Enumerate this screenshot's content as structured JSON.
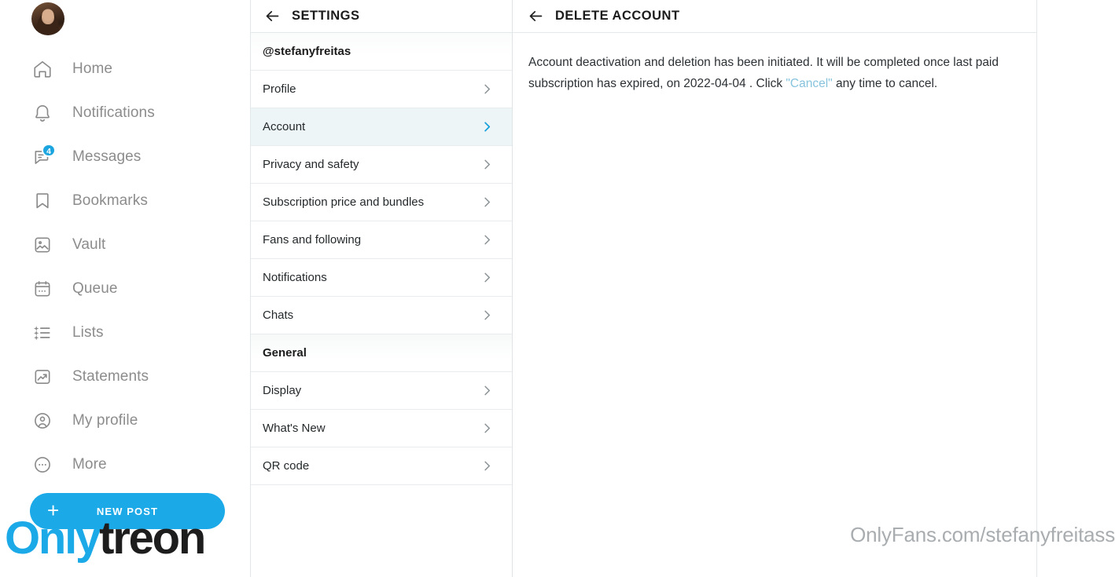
{
  "sidebar": {
    "avatar_alt": "user-avatar",
    "items": [
      {
        "label": "Home",
        "icon": "home-icon",
        "badge": null
      },
      {
        "label": "Notifications",
        "icon": "bell-icon",
        "badge": null
      },
      {
        "label": "Messages",
        "icon": "messages-icon",
        "badge": "4"
      },
      {
        "label": "Bookmarks",
        "icon": "bookmark-icon",
        "badge": null
      },
      {
        "label": "Vault",
        "icon": "vault-image-icon",
        "badge": null
      },
      {
        "label": "Queue",
        "icon": "calendar-icon",
        "badge": null
      },
      {
        "label": "Lists",
        "icon": "list-star-icon",
        "badge": null
      },
      {
        "label": "Statements",
        "icon": "chart-frame-icon",
        "badge": null
      },
      {
        "label": "My profile",
        "icon": "profile-circle-icon",
        "badge": null
      },
      {
        "label": "More",
        "icon": "ellipsis-circle-icon",
        "badge": null
      }
    ],
    "new_post_label": "NEW POST",
    "new_post_icon": "plus-icon",
    "brand_primary": "Only",
    "brand_secondary": "treon"
  },
  "settings": {
    "header_title": "SETTINGS",
    "back_icon": "arrow-left-icon",
    "username": "@stefanyfreitas",
    "account_rows": [
      {
        "label": "Profile",
        "active": false
      },
      {
        "label": "Account",
        "active": true
      },
      {
        "label": "Privacy and safety",
        "active": false
      },
      {
        "label": "Subscription price and bundles",
        "active": false
      },
      {
        "label": "Fans and following",
        "active": false
      },
      {
        "label": "Notifications",
        "active": false
      },
      {
        "label": "Chats",
        "active": false
      }
    ],
    "general_section_label": "General",
    "general_rows": [
      {
        "label": "Display",
        "active": false
      },
      {
        "label": "What's New",
        "active": false
      },
      {
        "label": "QR code",
        "active": false
      }
    ]
  },
  "content": {
    "header_title": "DELETE ACCOUNT",
    "back_icon": "arrow-left-icon",
    "message_part1": "Account deactivation and deletion has been initiated. It will be completed once last paid subscription has expired, on 2022-04-04 . Click ",
    "message_link": "\"Cancel\"",
    "message_part2": " any time to cancel.",
    "expiry_date": "2022-04-04"
  },
  "watermark": {
    "url": "OnlyFans.com/stefanyfreitass"
  },
  "colors": {
    "accent_blue": "#1ca9e8",
    "link_blue": "#86c3dd",
    "active_row_bg": "#eef5f7",
    "text_gray": "#8c8c8c"
  }
}
